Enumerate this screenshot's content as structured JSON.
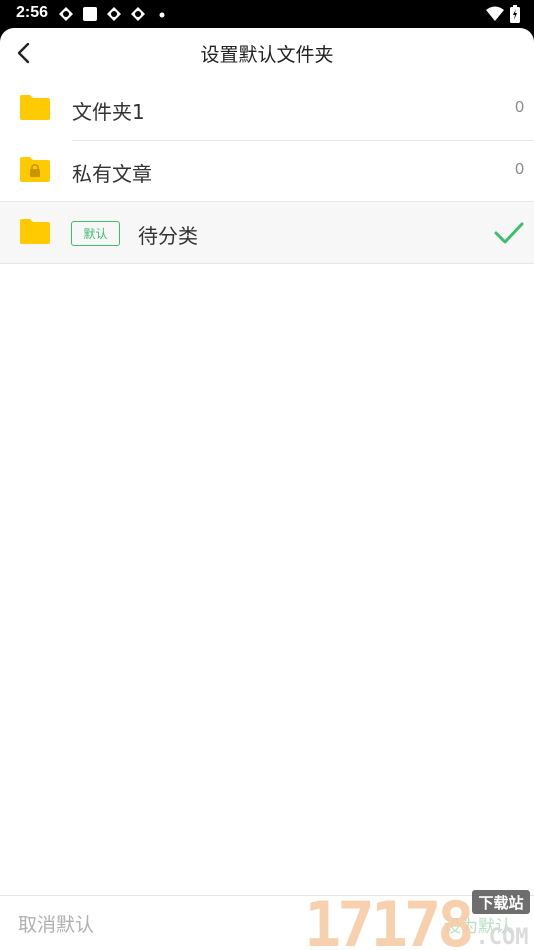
{
  "status_bar": {
    "time": "2:56",
    "icons_left": [
      "notification-icon",
      "notification-icon",
      "notification-icon",
      "notification-icon",
      "dot-icon"
    ],
    "icons_right": [
      "wifi-icon",
      "battery-icon"
    ]
  },
  "header": {
    "title": "设置默认文件夹",
    "back_icon": "chevron-left-icon"
  },
  "folders": [
    {
      "name": "文件夹1",
      "count": "0",
      "icon": "folder-icon",
      "selected": false
    },
    {
      "name": "私有文章",
      "count": "0",
      "icon": "locked-folder-icon",
      "selected": false
    },
    {
      "name": "待分类",
      "badge": "默认",
      "icon": "folder-icon",
      "selected": true
    }
  ],
  "bottom_bar": {
    "cancel_label": "取消默认",
    "confirm_label": "设为默认"
  },
  "watermark": {
    "number": "17178",
    "site": "下载站",
    "domain": ".COM"
  },
  "colors": {
    "folder": "#FFCB00",
    "accent_green": "#3dbe6c",
    "background": "#ffffff"
  }
}
